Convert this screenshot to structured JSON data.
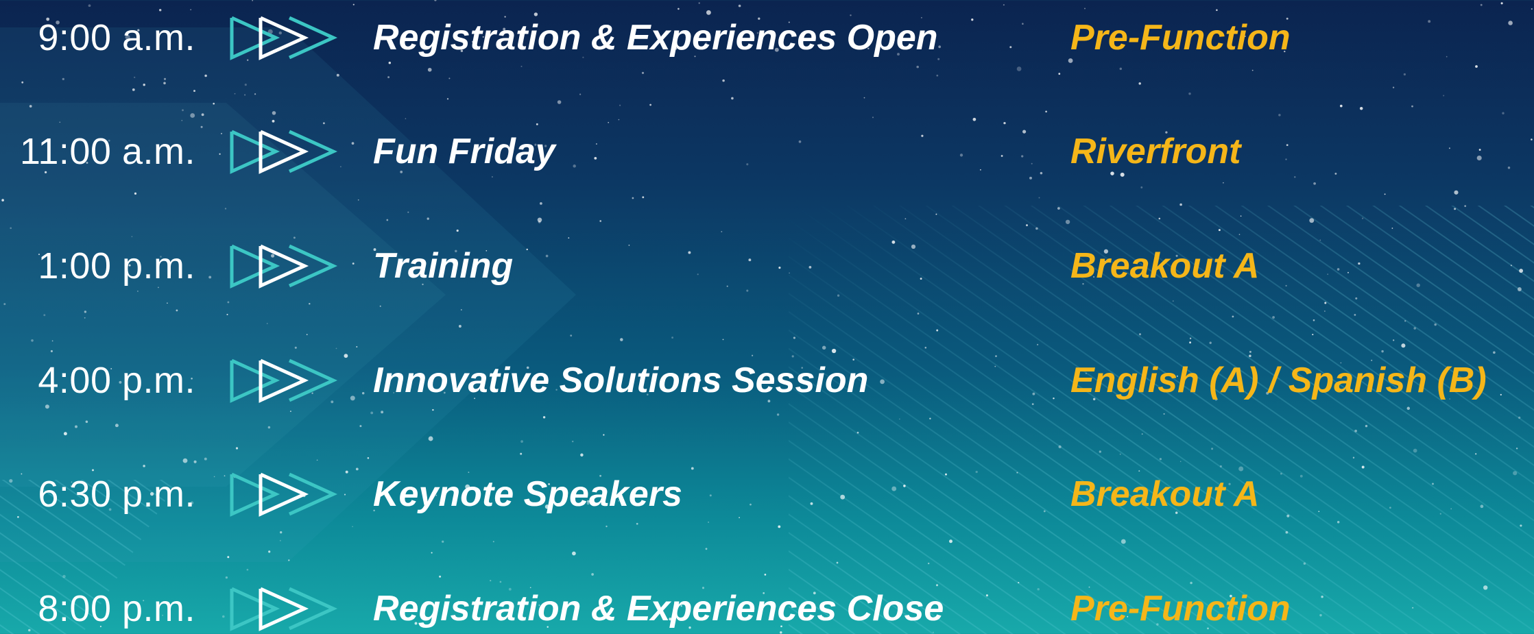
{
  "theme": {
    "time_color": "#ffffff",
    "title_color": "#ffffff",
    "location_color": "#f5b619",
    "chevron_color": "#3cc6c4",
    "chevron_outline_color": "#ffffff"
  },
  "schedule": [
    {
      "time": "9:00 a.m.",
      "title": "Registration & Experiences Open",
      "location": "Pre-Function",
      "icon": "double-chevron-right-icon"
    },
    {
      "time": "11:00 a.m.",
      "title": "Fun Friday",
      "location": "Riverfront",
      "icon": "double-chevron-right-icon"
    },
    {
      "time": "1:00 p.m.",
      "title": "Training",
      "location": "Breakout A",
      "icon": "double-chevron-right-icon"
    },
    {
      "time": "4:00 p.m.",
      "title": "Innovative Solutions Session",
      "location": "English (A) / Spanish (B)",
      "icon": "double-chevron-right-icon"
    },
    {
      "time": "6:30 p.m.",
      "title": "Keynote Speakers",
      "location": "Breakout A",
      "icon": "double-chevron-right-icon"
    },
    {
      "time": "8:00 p.m.",
      "title": "Registration & Experiences Close",
      "location": "Pre-Function",
      "icon": "double-chevron-right-icon"
    }
  ]
}
